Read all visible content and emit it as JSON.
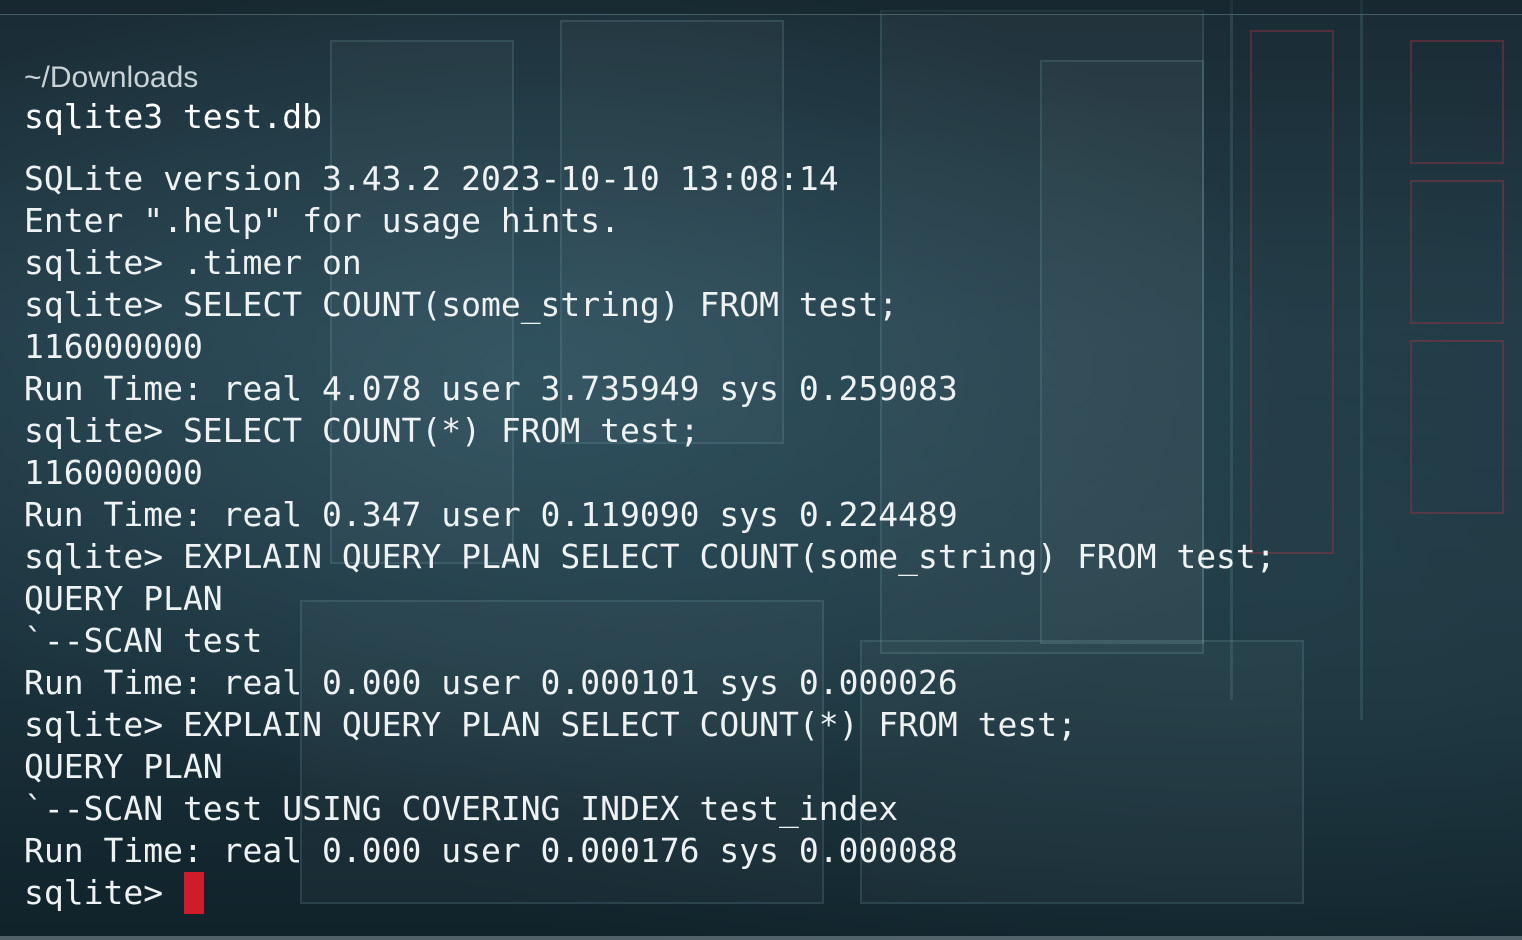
{
  "terminal": {
    "cwd": "~/Downloads",
    "command": "sqlite3 test.db",
    "lines": [
      "SQLite version 3.43.2 2023-10-10 13:08:14",
      "Enter \".help\" for usage hints.",
      "sqlite> .timer on",
      "sqlite> SELECT COUNT(some_string) FROM test;",
      "116000000",
      "Run Time: real 4.078 user 3.735949 sys 0.259083",
      "sqlite> SELECT COUNT(*) FROM test;",
      "116000000",
      "Run Time: real 0.347 user 0.119090 sys 0.224489",
      "sqlite> EXPLAIN QUERY PLAN SELECT COUNT(some_string) FROM test;",
      "QUERY PLAN",
      "`--SCAN test",
      "Run Time: real 0.000 user 0.000101 sys 0.000026",
      "sqlite> EXPLAIN QUERY PLAN SELECT COUNT(*) FROM test;",
      "QUERY PLAN",
      "`--SCAN test USING COVERING INDEX test_index",
      "Run Time: real 0.000 user 0.000176 sys 0.000088"
    ],
    "prompt": "sqlite> ",
    "cursor_color": "#d01b2a"
  }
}
